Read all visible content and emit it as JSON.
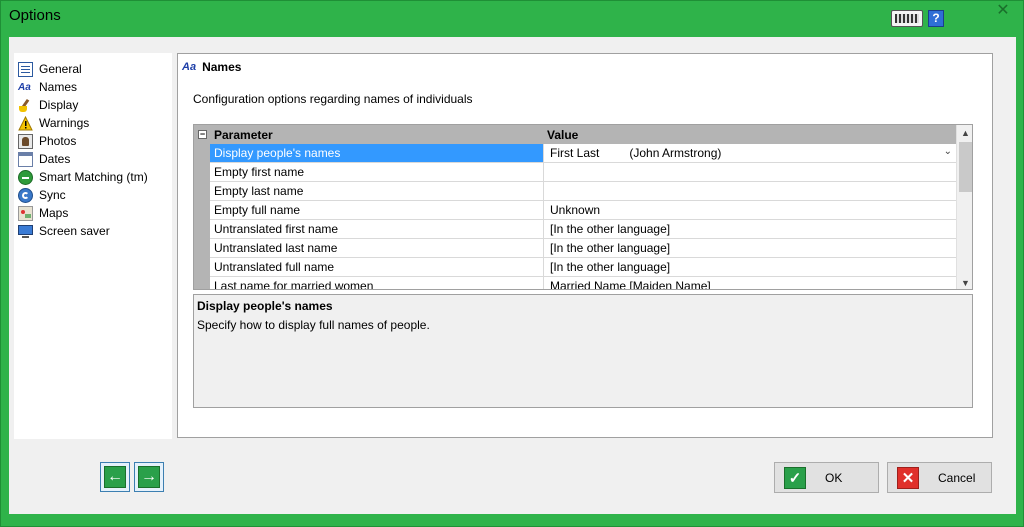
{
  "window": {
    "title": "Options"
  },
  "titlebar": {
    "help_label": "?",
    "close_label": "✕"
  },
  "nav": {
    "items": [
      {
        "label": "General",
        "icon": "document-icon"
      },
      {
        "label": "Names",
        "icon": "font-aa-icon"
      },
      {
        "label": "Display",
        "icon": "brush-icon"
      },
      {
        "label": "Warnings",
        "icon": "warning-icon"
      },
      {
        "label": "Photos",
        "icon": "photo-icon"
      },
      {
        "label": "Dates",
        "icon": "calendar-icon"
      },
      {
        "label": "Smart Matching (tm)",
        "icon": "smart-matching-icon"
      },
      {
        "label": "Sync",
        "icon": "sync-icon"
      },
      {
        "label": "Maps",
        "icon": "map-icon"
      },
      {
        "label": "Screen saver",
        "icon": "monitor-icon"
      }
    ],
    "selected": "Names"
  },
  "panel": {
    "icon_text": "Aa",
    "title": "Names",
    "description": "Configuration options regarding names of individuals"
  },
  "grid": {
    "collapse_label": "−",
    "columns": [
      "Parameter",
      "Value"
    ],
    "rows": [
      {
        "parameter": "Display people's names",
        "value": "First Last",
        "preview": "(John Armstrong)",
        "selected": true
      },
      {
        "parameter": "Empty first name",
        "value": ""
      },
      {
        "parameter": "Empty last name",
        "value": ""
      },
      {
        "parameter": "Empty full name",
        "value": "Unknown"
      },
      {
        "parameter": "Untranslated first name",
        "value": "[In the other language]"
      },
      {
        "parameter": "Untranslated last name",
        "value": "[In the other language]"
      },
      {
        "parameter": "Untranslated full name",
        "value": "[In the other language]"
      },
      {
        "parameter": "Last name for married women",
        "value": "Married Name [Maiden Name]"
      }
    ],
    "dropdown_arrow": "⌄",
    "scroll_up": "▲",
    "scroll_down": "▼"
  },
  "help": {
    "title": "Display people's names",
    "text": "Specify how to display full names of people."
  },
  "footer": {
    "back_symbol": "←",
    "forward_symbol": "→",
    "ok_label": "OK",
    "ok_symbol": "✓",
    "cancel_label": "Cancel",
    "cancel_symbol": "✕"
  },
  "colors": {
    "window_frame": "#2fb34a",
    "selection": "#3399ff",
    "ok_icon": "#2aa04a",
    "cancel_icon": "#e0302b"
  }
}
